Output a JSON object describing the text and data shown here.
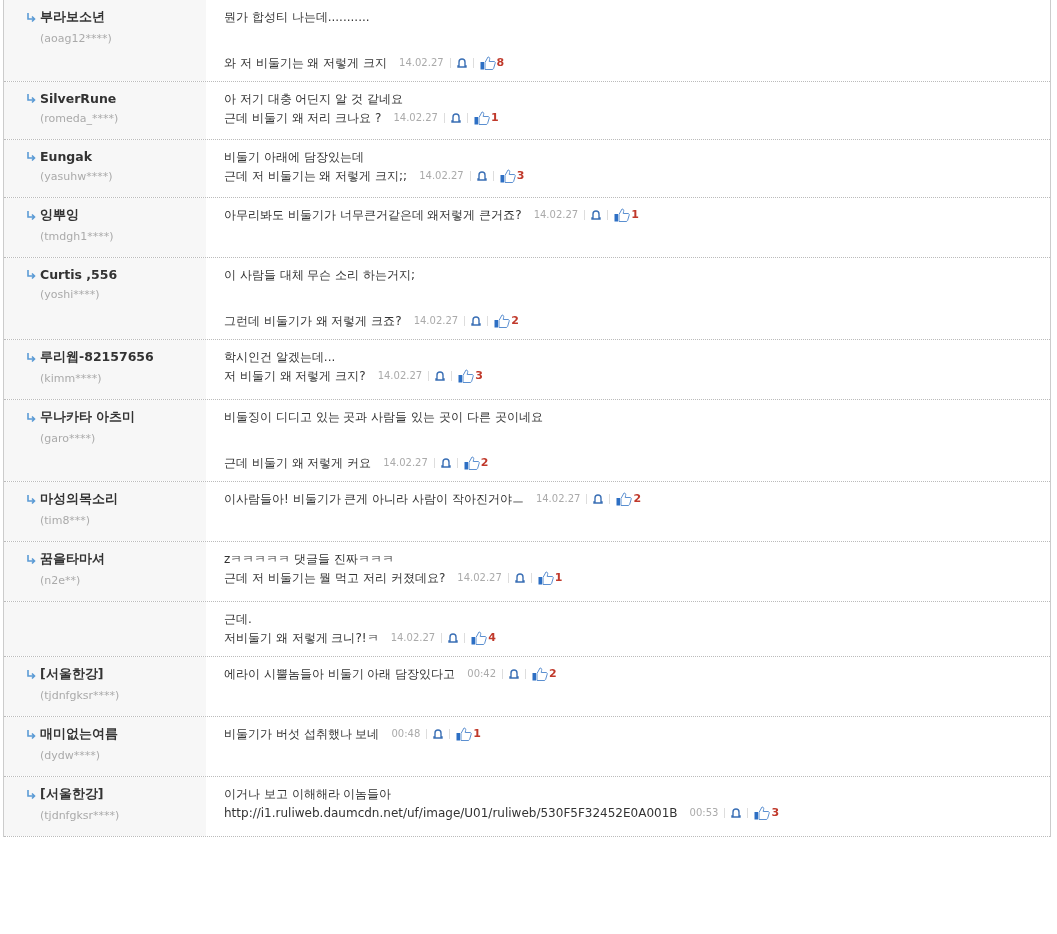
{
  "comments": [
    {
      "author": "부라보소년",
      "user_id": "(aoag12****)",
      "paragraphs": [
        [
          "뭔가 합성티 나는데..........."
        ],
        [
          "와 저 비둘기는 왜 저렇게 크지"
        ]
      ],
      "date": "14.02.27",
      "likes": "8"
    },
    {
      "author": "SilverRune",
      "user_id": "(romeda_****)",
      "paragraphs": [
        [
          "아 저기 대충 어딘지 알 것 같네요",
          "근데 비둘기 왜 저리 크나요 ?"
        ]
      ],
      "date": "14.02.27",
      "likes": "1"
    },
    {
      "author": "Eungak",
      "user_id": "(yasuhw****)",
      "paragraphs": [
        [
          "비둘기 아래에 담장있는데",
          "근데 저 비둘기는 왜 저렇게 크지;;"
        ]
      ],
      "date": "14.02.27",
      "likes": "3"
    },
    {
      "author": "잉뿌잉",
      "user_id": "(tmdgh1****)",
      "paragraphs": [
        [
          "아무리봐도 비둘기가 너무큰거같은데 왜저렇게 큰거죠?"
        ]
      ],
      "date": "14.02.27",
      "likes": "1"
    },
    {
      "author": "Curtis ,556",
      "user_id": "(yoshi****)",
      "paragraphs": [
        [
          "이 사람들 대체 무슨 소리 하는거지;"
        ],
        [
          "그런데 비둘기가 왜 저렇게 크죠?"
        ]
      ],
      "date": "14.02.27",
      "likes": "2"
    },
    {
      "author": "루리웹-82157656",
      "user_id": "(kimm****)",
      "paragraphs": [
        [
          "학시인건 알겠는데...",
          "저 비둘기 왜 저렇게 크지?"
        ]
      ],
      "date": "14.02.27",
      "likes": "3"
    },
    {
      "author": "무나카타 아츠미",
      "user_id": "(garo****)",
      "paragraphs": [
        [
          "비둘징이 디디고 있는 곳과 사람들 있는 곳이 다른 곳이네요"
        ],
        [
          "근데 비둘기 왜 저렇게 커요"
        ]
      ],
      "date": "14.02.27",
      "likes": "2"
    },
    {
      "author": "마성의목소리",
      "user_id": "(tim8***)",
      "paragraphs": [
        [
          "이사람들아! 비둘기가 큰게 아니라 사람이 작아진거야ㅡ"
        ]
      ],
      "date": "14.02.27",
      "likes": "2"
    },
    {
      "author": "꿈을타마셔",
      "user_id": "(n2e**)",
      "paragraphs": [
        [
          "zㅋㅋㅋㅋㅋ 댓글들 진짜ㅋㅋㅋ",
          "근데 저 비둘기는 뭘 먹고 저리 커졌데요?"
        ]
      ],
      "date": "14.02.27",
      "likes": "1"
    },
    {
      "paragraphs": [
        [
          "근데.",
          "저비둘기 왜 저렇게 크니?!ㅋ"
        ]
      ],
      "date": "14.02.27",
      "likes": "4"
    },
    {
      "author": "[서울한강]",
      "user_id": "(tjdnfgksr****)",
      "paragraphs": [
        [
          "에라이 시뿔놈들아 비둘기 아래 담장있다고"
        ]
      ],
      "date": "00:42",
      "likes": "2"
    },
    {
      "author": "매미없는여름",
      "user_id": "(dydw****)",
      "paragraphs": [
        [
          "비둘기가 버섯 섭취했나 보네"
        ]
      ],
      "date": "00:48",
      "likes": "1"
    },
    {
      "author": "[서울한강]",
      "user_id": "(tjdnfgksr****)",
      "paragraphs": [
        [
          "이거나 보고 이해해라 이놈들아",
          "http://i1.ruliweb.daumcdn.net/uf/image/U01/ruliweb/530F5F32452E0A001B"
        ]
      ],
      "date": "00:53",
      "likes": "3"
    }
  ]
}
